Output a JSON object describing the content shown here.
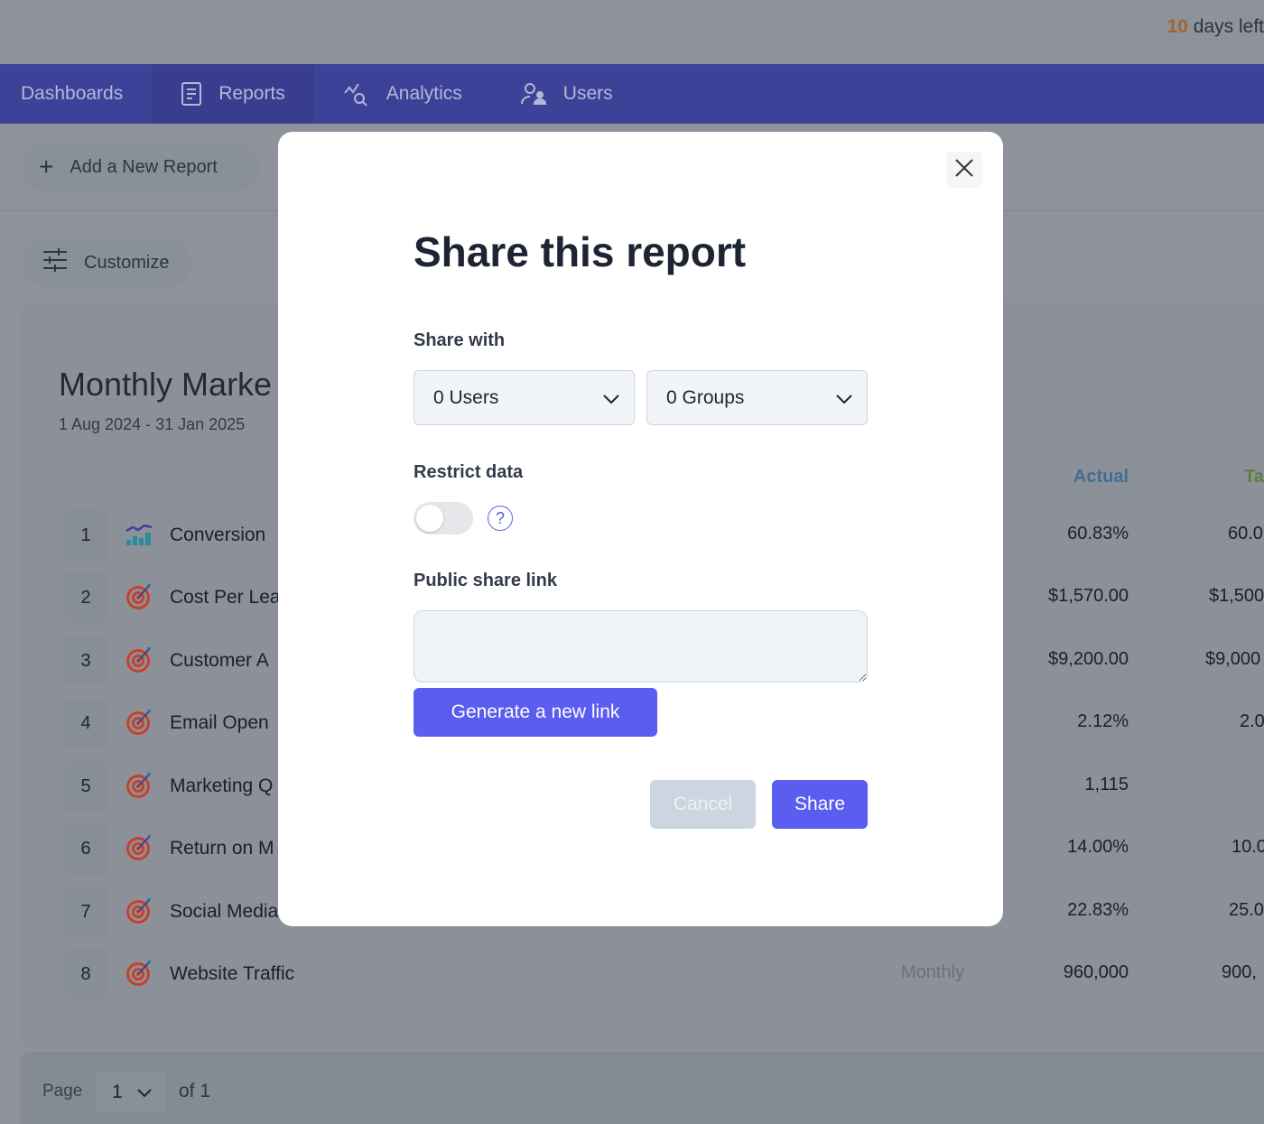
{
  "trial": {
    "days": "10",
    "text": "days left"
  },
  "nav": {
    "tabs": [
      {
        "label": "Dashboards",
        "icon": "none"
      },
      {
        "label": "Reports",
        "icon": "document-icon",
        "active": true
      },
      {
        "label": "Analytics",
        "icon": "analytics-icon"
      },
      {
        "label": "Users",
        "icon": "users-icon"
      }
    ]
  },
  "toolbar": {
    "add_report": "Add a New Report",
    "customize": "Customize"
  },
  "report": {
    "title": "Monthly Marke",
    "date_range": "1 Aug 2024 - 31 Jan 2025",
    "columns": {
      "actual": "Actual",
      "target": "Ta"
    },
    "colors": {
      "actual_header": "#3f6e8f",
      "target_header": "#5c7f3c",
      "target_icon": "#c8402c"
    },
    "rows": [
      {
        "num": "1",
        "name": "Conversion",
        "icon": "chart-icon",
        "frequency": "",
        "actual": "60.83%",
        "target": "60.0"
      },
      {
        "num": "2",
        "name": "Cost Per Lea",
        "icon": "target-icon",
        "frequency": "",
        "actual": "$1,570.00",
        "target": "$1,500"
      },
      {
        "num": "3",
        "name": "Customer A",
        "icon": "target-icon",
        "frequency": "",
        "actual": "$9,200.00",
        "target": "$9,000"
      },
      {
        "num": "4",
        "name": "Email Open",
        "icon": "target-icon",
        "frequency": "",
        "actual": "2.12%",
        "target": "2.0"
      },
      {
        "num": "5",
        "name": "Marketing Q",
        "icon": "target-icon",
        "frequency": "",
        "actual": "1,115",
        "target": ""
      },
      {
        "num": "6",
        "name": "Return on M",
        "icon": "target-icon",
        "frequency": "",
        "actual": "14.00%",
        "target": "10.0"
      },
      {
        "num": "7",
        "name": "Social Media",
        "icon": "target-icon",
        "frequency": "",
        "actual": "22.83%",
        "target": "25.0"
      },
      {
        "num": "8",
        "name": "Website Traffic",
        "icon": "target-icon",
        "frequency": "Monthly",
        "actual": "960,000",
        "target": "900,"
      }
    ]
  },
  "pagination": {
    "label": "Page",
    "current": "1",
    "of": "of 1"
  },
  "modal": {
    "title": "Share this report",
    "share_with": "Share with",
    "users": "0 Users",
    "groups": "0 Groups",
    "restrict": "Restrict data",
    "restrict_on": false,
    "help": "?",
    "public_link": "Public share link",
    "link_value": "",
    "generate": "Generate a new link",
    "cancel": "Cancel",
    "share": "Share",
    "accent": "#5b5cf0"
  }
}
